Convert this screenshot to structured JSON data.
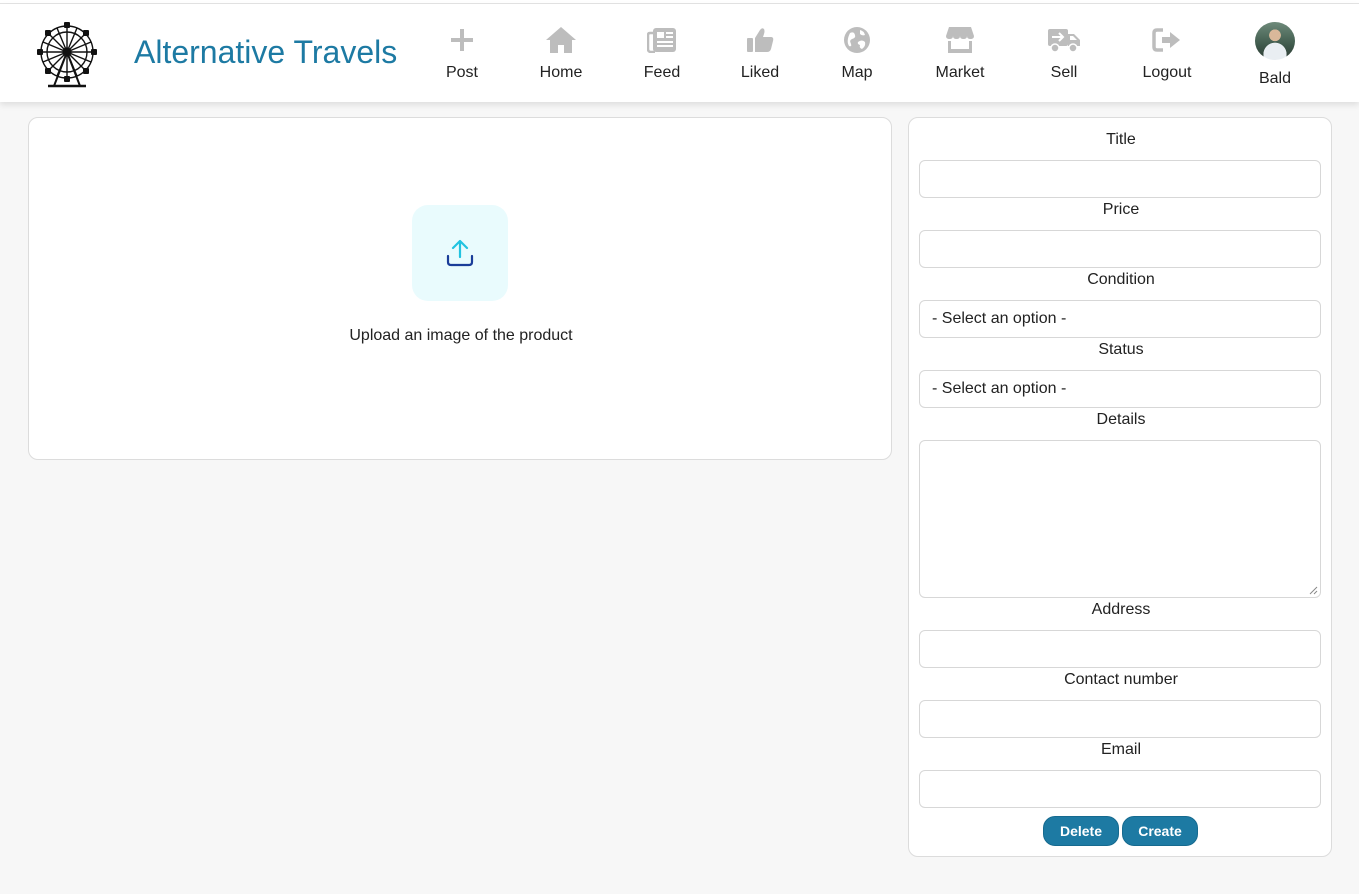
{
  "app": {
    "title": "Alternative Travels",
    "logo_icon": "ferris-wheel-icon",
    "accent_color": "#1d7aa3"
  },
  "nav": [
    {
      "label": "Post",
      "icon": "plus-icon"
    },
    {
      "label": "Home",
      "icon": "home-icon"
    },
    {
      "label": "Feed",
      "icon": "newspaper-icon"
    },
    {
      "label": "Liked",
      "icon": "thumbs-up-icon"
    },
    {
      "label": "Map",
      "icon": "globe-icon"
    },
    {
      "label": "Market",
      "icon": "store-icon"
    },
    {
      "label": "Sell",
      "icon": "truck-icon"
    },
    {
      "label": "Logout",
      "icon": "logout-icon"
    },
    {
      "label": "Bald",
      "icon": "avatar"
    }
  ],
  "upload": {
    "text": "Upload an image of the product",
    "icon": "upload-icon"
  },
  "form": {
    "title_label": "Title",
    "title_value": "",
    "price_label": "Price",
    "price_value": "",
    "condition_label": "Condition",
    "condition_value": "- Select an option -",
    "status_label": "Status",
    "status_value": "- Select an option -",
    "details_label": "Details",
    "details_value": "",
    "address_label": "Address",
    "address_value": "",
    "contact_label": "Contact number",
    "contact_value": "",
    "email_label": "Email",
    "email_value": "",
    "delete_label": "Delete",
    "create_label": "Create"
  }
}
